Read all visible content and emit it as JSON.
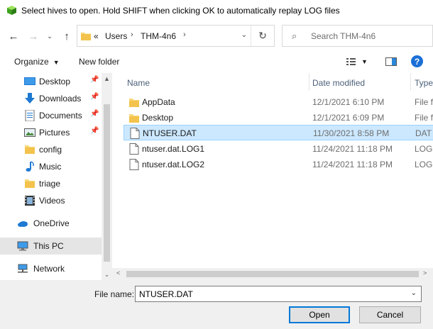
{
  "window": {
    "title": "Select hives to open. Hold SHIFT when clicking OK to automatically replay LOG files"
  },
  "address_bar": {
    "breadcrumbs": [
      "Users",
      "THM-4n6"
    ],
    "overflow": "«",
    "separator": "›"
  },
  "search": {
    "placeholder": "Search THM-4n6"
  },
  "toolbar": {
    "organize": "Organize",
    "new_folder": "New folder",
    "help": "?"
  },
  "nav_pane": {
    "items": [
      {
        "label": "Desktop",
        "icon": "desktop-icon",
        "pinned": true
      },
      {
        "label": "Downloads",
        "icon": "download-icon",
        "pinned": true
      },
      {
        "label": "Documents",
        "icon": "documents-icon",
        "pinned": true
      },
      {
        "label": "Pictures",
        "icon": "pictures-icon",
        "pinned": true
      },
      {
        "label": "config",
        "icon": "folder-icon",
        "pinned": false
      },
      {
        "label": "Music",
        "icon": "music-icon",
        "pinned": false
      },
      {
        "label": "triage",
        "icon": "folder-icon",
        "pinned": false
      },
      {
        "label": "Videos",
        "icon": "videos-icon",
        "pinned": false
      },
      {
        "label": "OneDrive",
        "icon": "cloud-icon",
        "pinned": false
      },
      {
        "label": "This PC",
        "icon": "computer-icon",
        "pinned": false,
        "selected": true
      },
      {
        "label": "Network",
        "icon": "network-icon",
        "pinned": false
      }
    ]
  },
  "file_list": {
    "columns": {
      "name": "Name",
      "date": "Date modified",
      "type": "Type"
    },
    "rows": [
      {
        "name": "AppData",
        "date": "12/1/2021 6:10 PM",
        "type": "File f",
        "kind": "folder"
      },
      {
        "name": "Desktop",
        "date": "12/1/2021 6:09 PM",
        "type": "File f",
        "kind": "folder"
      },
      {
        "name": "NTUSER.DAT",
        "date": "11/30/2021 8:58 PM",
        "type": "DAT F",
        "kind": "file",
        "selected": true
      },
      {
        "name": "ntuser.dat.LOG1",
        "date": "11/24/2021 11:18 PM",
        "type": "LOG1",
        "kind": "file"
      },
      {
        "name": "ntuser.dat.LOG2",
        "date": "11/24/2021 11:18 PM",
        "type": "LOG2",
        "kind": "file"
      }
    ]
  },
  "footer": {
    "file_name_label": "File name:",
    "file_name_value": "NTUSER.DAT",
    "open_label": "Open",
    "cancel_label": "Cancel"
  },
  "colors": {
    "accent": "#0078d7",
    "selection": "#cce8ff",
    "folder": "#f8d775",
    "help": "#1a6fd6"
  }
}
